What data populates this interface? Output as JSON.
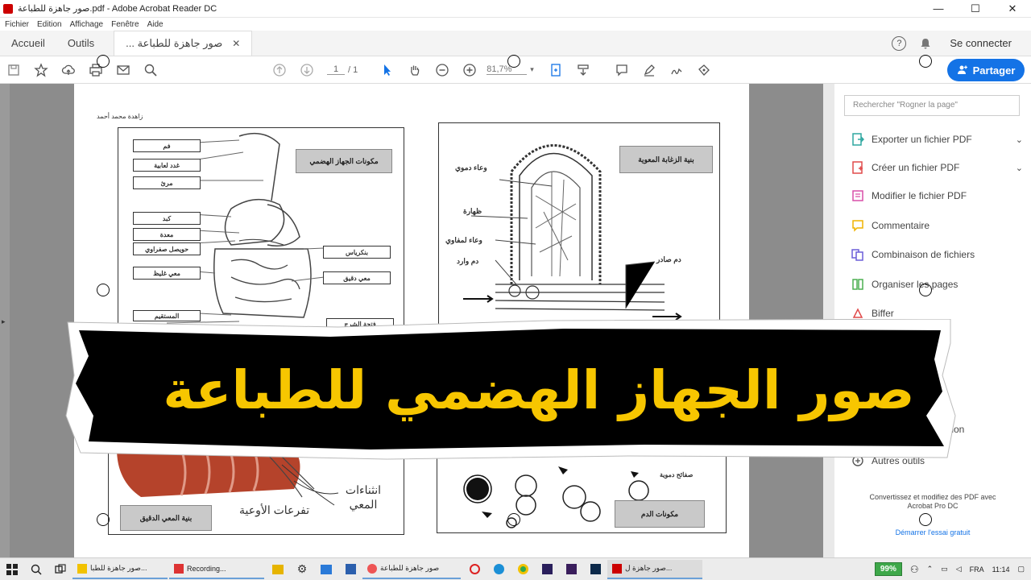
{
  "window": {
    "title": "صور جاهزة للطباعة.pdf - Adobe Acrobat Reader DC",
    "minimize": "—",
    "maximize": "☐",
    "close": "✕"
  },
  "menu": [
    "Fichier",
    "Edition",
    "Affichage",
    "Fenêtre",
    "Aide"
  ],
  "tabs": {
    "home": "Accueil",
    "tools": "Outils",
    "doc": "صور جاهزة للطباعة ...",
    "doc_close": "✕",
    "help": "?",
    "signin": "Se connecter"
  },
  "toolbar": {
    "page_current": "1",
    "page_total": "/ 1",
    "zoom": "81,7%",
    "share": "Partager"
  },
  "document": {
    "author": "زاهدة محمد أحمد",
    "panel1": {
      "title": "مكونات الجهاز الهضمي",
      "labels_left": [
        "فم",
        "غدد لعابية",
        "مرئ",
        "كبد",
        "معدة",
        "حويصل صفراوي",
        "معي غليظ",
        "المستقيم",
        "فتحة الشرج"
      ],
      "labels_right": [
        "بنكرياس",
        "معي دقيق"
      ]
    },
    "panel2": {
      "title": "بنية الزغابة المعوية",
      "labels": [
        "وعاء دموي",
        "ظهارة",
        "وعاء لمفاوي",
        "دم وارد",
        "دم صادر"
      ]
    },
    "panel3": {
      "title": "بنية المعي الدقيق",
      "labels": [
        "انثناءات المعي",
        "تفرعات الأوعية"
      ]
    },
    "panel4": {
      "title": "مكونات الدم",
      "labels": [
        "صفائح دموية"
      ]
    }
  },
  "sidepanel": {
    "search_placeholder": "Rechercher \"Rogner la page\"",
    "tools": [
      {
        "label": "Exporter un fichier PDF",
        "color": "#2fa7a0",
        "chevron": "⌄"
      },
      {
        "label": "Créer un fichier PDF",
        "color": "#e04a4a",
        "chevron": "⌄"
      },
      {
        "label": "Modifier le fichier PDF",
        "color": "#d94fa8",
        "chevron": ""
      },
      {
        "label": "Commentaire",
        "color": "#f0b400",
        "chevron": ""
      },
      {
        "label": "Combinaison de fichiers",
        "color": "#6b5fd8",
        "chevron": ""
      },
      {
        "label": "Organiser les pages",
        "color": "#4caf50",
        "chevron": ""
      },
      {
        "label": "Biffer",
        "color": "#e04a4a",
        "chevron": ""
      },
      {
        "label": "révision",
        "color": "#1473e6",
        "chevron": ""
      },
      {
        "label": "Autres outils",
        "color": "#555555",
        "chevron": ""
      }
    ],
    "promo": "Convertissez et modifiez des PDF avec Acrobat Pro DC",
    "promo_link": "Démarrer l'essai gratuit"
  },
  "banner": {
    "text": "صور الجهاز الهضمي للطباعة",
    "text_color": "#f7c600",
    "bg_color": "#000000"
  },
  "taskbar": {
    "apps": [
      {
        "label": "صور جاهزة للطبا...",
        "color": "#f2c200"
      },
      {
        "label": "Recording...",
        "color": "#d33"
      },
      {
        "label": "صور جاهزة للطباعة",
        "color": "#e55"
      },
      {
        "label": "صور جاهزة ل...",
        "color": "#c00"
      }
    ],
    "battery": "99%",
    "lang": "FRA",
    "time": "11:14"
  }
}
